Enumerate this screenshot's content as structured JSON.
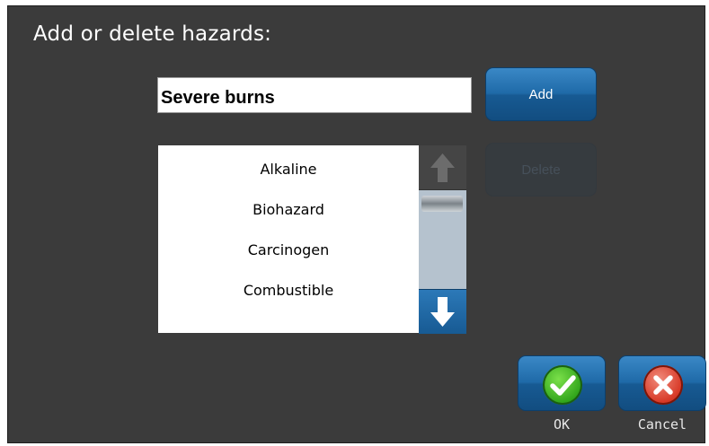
{
  "dialog": {
    "title": "Add or delete hazards:"
  },
  "input": {
    "value": "Severe burns"
  },
  "buttons": {
    "add_label": "Add",
    "delete_label": "Delete",
    "ok_label": "OK",
    "cancel_label": "Cancel"
  },
  "hazard_list": {
    "items": [
      "Alkaline",
      "Biohazard",
      "Carcinogen",
      "Combustible"
    ]
  },
  "icons": {
    "scroll_up": "arrow-up-icon",
    "scroll_down": "arrow-down-icon",
    "ok": "check-icon",
    "cancel": "x-icon"
  },
  "colors": {
    "background": "#3b3b3b",
    "accent": "#1f6aa8",
    "ok_green": "#2fa31a",
    "cancel_red": "#d83a28"
  }
}
